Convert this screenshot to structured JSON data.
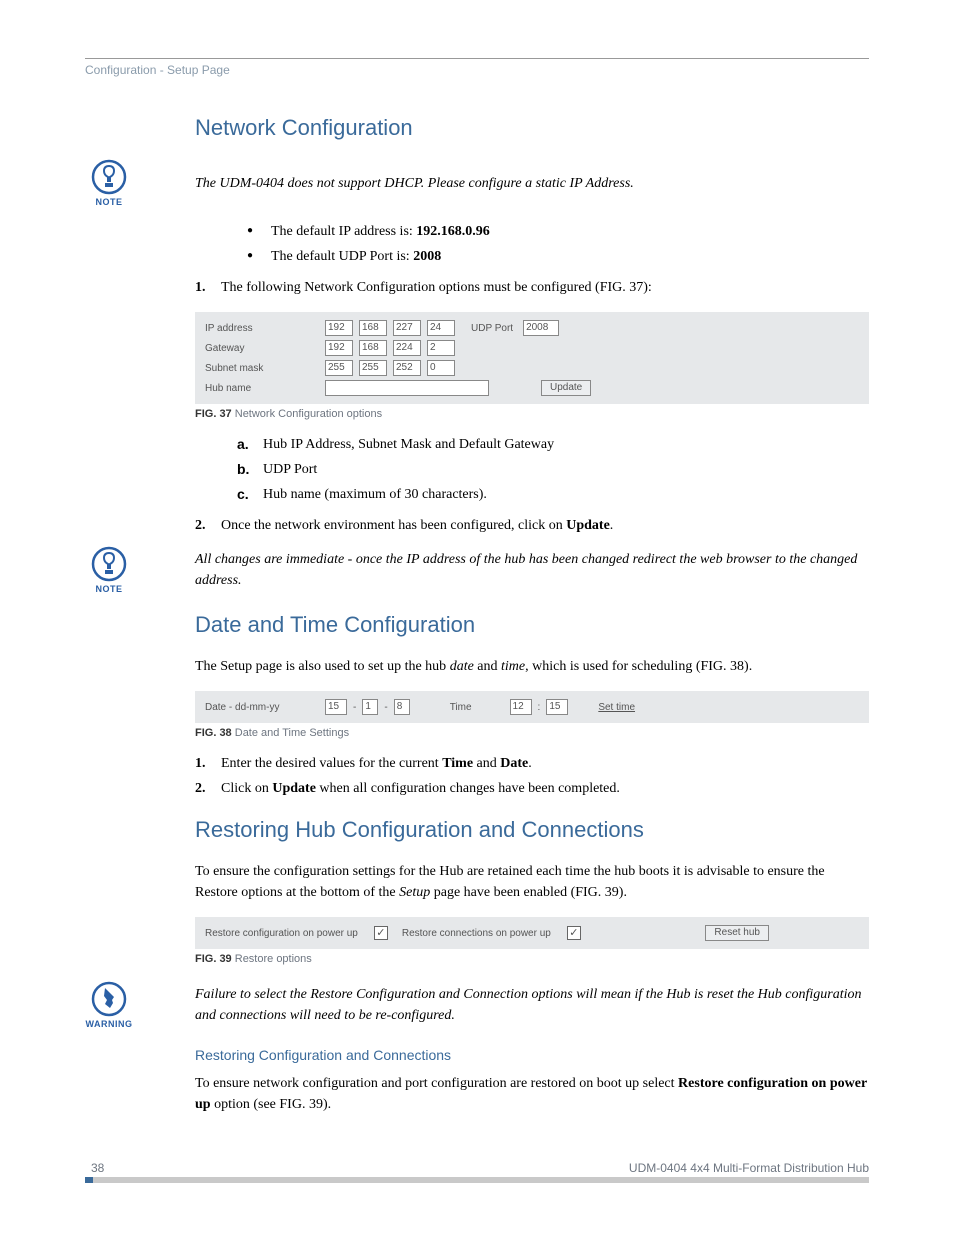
{
  "header": {
    "breadcrumb": "Configuration - Setup Page"
  },
  "sections": {
    "network": {
      "title": "Network Configuration",
      "note1": "The UDM-0404 does not support DHCP.   Please configure a static IP Address.",
      "bullet1_a": "The default IP address is: ",
      "bullet1_b": "192.168.0.96",
      "bullet2_a": "The default UDP Port is: ",
      "bullet2_b": "2008",
      "step1": "The following Network Configuration options must be configured (FIG. 37):",
      "fig37": {
        "ip_label": "IP address",
        "ip": [
          "192",
          "168",
          "227",
          "24"
        ],
        "udp_label": "UDP Port",
        "udp_port": "2008",
        "gw_label": "Gateway",
        "gw": [
          "192",
          "168",
          "224",
          "2"
        ],
        "mask_label": "Subnet mask",
        "mask": [
          "255",
          "255",
          "252",
          "0"
        ],
        "hub_label": "Hub name",
        "update_btn": "Update"
      },
      "figcap37_a": "FIG. 37",
      "figcap37_b": "  Network Configuration options",
      "sub_a": "Hub IP Address, Subnet Mask and Default Gateway",
      "sub_b": "UDP Port",
      "sub_c": "Hub name (maximum of 30 characters).",
      "step2_a": "Once the network environment has been configured, click on ",
      "step2_b": "Update",
      "step2_c": ".",
      "note2": "All changes are immediate - once the IP address of the hub has been changed redirect the web browser to the changed address."
    },
    "datetime": {
      "title": "Date and Time Configuration",
      "intro_a": "The Setup page is also used to set up the hub ",
      "intro_b": "date",
      "intro_c": " and ",
      "intro_d": "time",
      "intro_e": ", which is used for scheduling (FIG. 38).",
      "fig38": {
        "date_label": "Date - dd-mm-yy",
        "date": [
          "15",
          "1",
          "8"
        ],
        "time_label": "Time",
        "time": [
          "12",
          "15"
        ],
        "set_time": "Set time"
      },
      "figcap38_a": "FIG. 38",
      "figcap38_b": "  Date and Time Settings",
      "step1_a": "Enter the desired values for the current ",
      "step1_b": "Time",
      "step1_c": " and ",
      "step1_d": "Date",
      "step1_e": ".",
      "step2_a": "Click on ",
      "step2_b": "Update",
      "step2_c": " when all configuration changes have been completed."
    },
    "restore": {
      "title": "Restoring Hub Configuration and Connections",
      "intro_a": "To ensure the configuration settings for the Hub are retained each time the hub boots it is advisable to ensure the Restore options at the bottom of the ",
      "intro_b": "Setup",
      "intro_c": " page have been enabled (FIG. 39).",
      "fig39": {
        "cfg_label": "Restore configuration on power up",
        "conn_label": "Restore connections on power up",
        "reset_btn": "Reset hub"
      },
      "figcap39_a": "FIG. 39",
      "figcap39_b": "  Restore options",
      "warn": "Failure to select the Restore Configuration and Connection options will mean if the Hub is reset the Hub configuration and connections will need to be re-configured.",
      "subhead": "Restoring Configuration and Connections",
      "para_a": "To ensure network configuration and port configuration are restored on boot up select ",
      "para_b": "Restore configuration on power up",
      "para_c": " option (see FIG. 39)."
    }
  },
  "footer": {
    "page": "38",
    "doc": "UDM-0404 4x4 Multi-Format Distribution Hub"
  },
  "icons": {
    "note_label": "NOTE",
    "warn_label": "WARNING"
  }
}
